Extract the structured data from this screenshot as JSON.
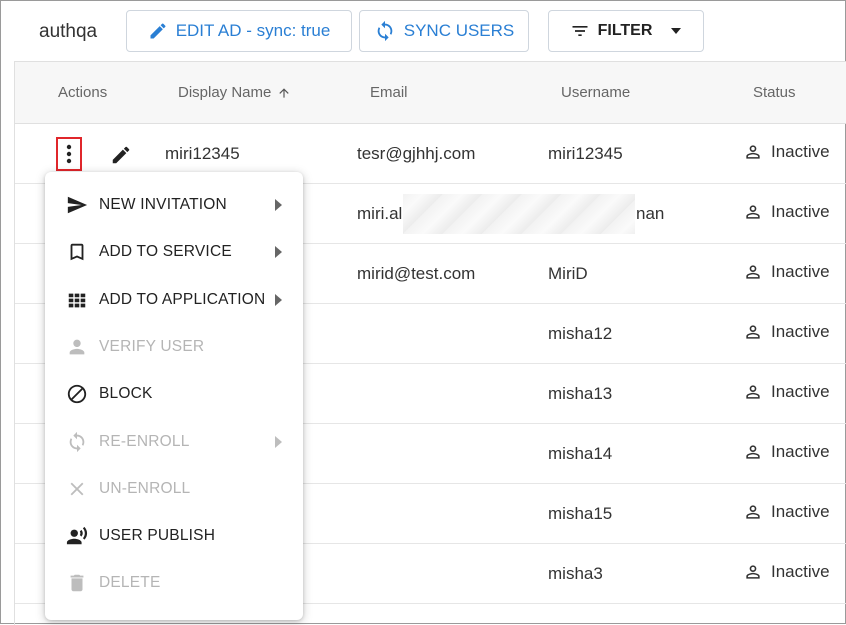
{
  "header": {
    "tenant": "authqa",
    "edit_ad_label": "EDIT AD - sync: true",
    "sync_users_label": "SYNC USERS",
    "filter_label": "FILTER"
  },
  "colors": {
    "accent": "#2a7fd4",
    "highlight": "#e0262b"
  },
  "table": {
    "columns": [
      "Actions",
      "Display Name",
      "Email",
      "Username",
      "Status"
    ],
    "sort": {
      "column": "Display Name",
      "direction": "ascending"
    },
    "rows": [
      {
        "display_name": "miri12345",
        "email": "tesr@gjhhj.com",
        "username": "miri12345",
        "status": "Inactive"
      },
      {
        "display_name": "",
        "email": "miri.al",
        "username": "nan",
        "status": "Inactive"
      },
      {
        "display_name": "",
        "email": "mirid@test.com",
        "username": "MiriD",
        "status": "Inactive"
      },
      {
        "display_name": "",
        "email": "",
        "username": "misha12",
        "status": "Inactive"
      },
      {
        "display_name": "",
        "email": "",
        "username": "misha13",
        "status": "Inactive"
      },
      {
        "display_name": "",
        "email": "",
        "username": "misha14",
        "status": "Inactive"
      },
      {
        "display_name": "",
        "email": "",
        "username": "misha15",
        "status": "Inactive"
      },
      {
        "display_name": "",
        "email": "",
        "username": "misha3",
        "status": "Inactive"
      }
    ]
  },
  "context_menu": {
    "items": [
      {
        "label": "NEW INVITATION",
        "icon": "send-icon",
        "disabled": false,
        "submenu": true
      },
      {
        "label": "ADD TO SERVICE",
        "icon": "bookmark-icon",
        "disabled": false,
        "submenu": true
      },
      {
        "label": "ADD TO APPLICATION",
        "icon": "apps-grid-icon",
        "disabled": false,
        "submenu": true
      },
      {
        "label": "VERIFY USER",
        "icon": "person-icon",
        "disabled": true,
        "submenu": false
      },
      {
        "label": "BLOCK",
        "icon": "block-icon",
        "disabled": false,
        "submenu": false
      },
      {
        "label": "RE-ENROLL",
        "icon": "sync-icon",
        "disabled": true,
        "submenu": true
      },
      {
        "label": "UN-ENROLL",
        "icon": "close-icon",
        "disabled": true,
        "submenu": false
      },
      {
        "label": "USER PUBLISH",
        "icon": "record-voice-icon",
        "disabled": false,
        "submenu": false
      },
      {
        "label": "DELETE",
        "icon": "trash-icon",
        "disabled": true,
        "submenu": false
      }
    ]
  }
}
